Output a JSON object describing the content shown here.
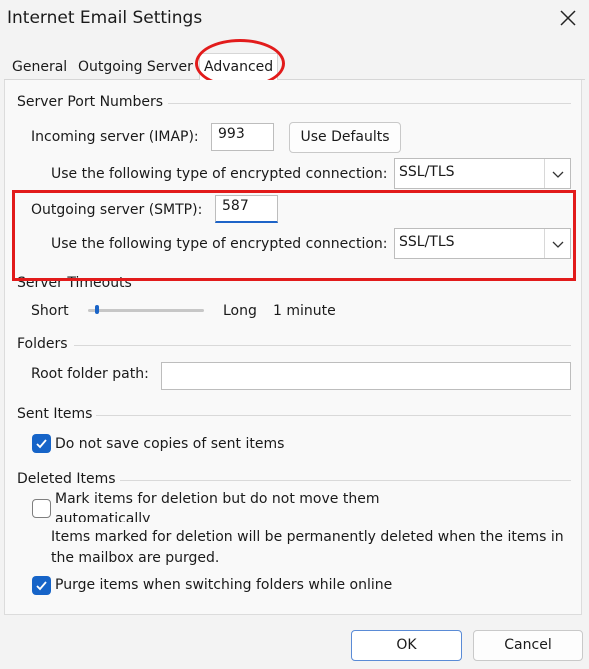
{
  "window": {
    "title": "Internet Email Settings",
    "close_icon": "close-icon"
  },
  "tabs": [
    {
      "label": "General",
      "active": false
    },
    {
      "label": "Outgoing Server",
      "active": false
    },
    {
      "label": "Advanced",
      "active": true
    }
  ],
  "server_ports": {
    "section_label": "Server Port Numbers",
    "incoming_label": "Incoming server (IMAP):",
    "incoming_value": "993",
    "use_defaults_label": "Use Defaults",
    "incoming_encryption_label": "Use the following type of encrypted connection:",
    "incoming_encryption_value": "SSL/TLS",
    "outgoing_label": "Outgoing server (SMTP):",
    "outgoing_value": "587",
    "outgoing_encryption_label": "Use the following type of encrypted connection:",
    "outgoing_encryption_value": "SSL/TLS"
  },
  "timeouts": {
    "section_label": "Server Timeouts",
    "short_label": "Short",
    "long_label": "Long",
    "value_label": "1 minute",
    "slider_level": 0.08
  },
  "folders": {
    "section_label": "Folders",
    "root_label": "Root folder path:",
    "root_value": ""
  },
  "sent_items": {
    "section_label": "Sent Items",
    "no_save_label": "Do not save copies of sent items",
    "no_save_checked": true
  },
  "deleted_items": {
    "section_label": "Deleted Items",
    "mark_label_line1": "Mark items for deletion but do not move them",
    "mark_label_line2": "automatically",
    "mark_checked": false,
    "note_line1": "Items marked for deletion will be permanently deleted when the items in",
    "note_line2": "the mailbox are purged.",
    "purge_label": "Purge items when switching folders while online",
    "purge_checked": true
  },
  "footer": {
    "ok_label": "OK",
    "cancel_label": "Cancel"
  },
  "colors": {
    "annotation": "#e21b1b",
    "accent": "#1664c8"
  }
}
